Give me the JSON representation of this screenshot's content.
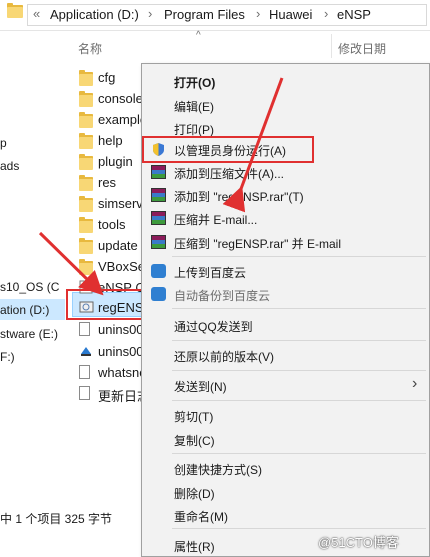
{
  "address_bar": {
    "overflow": "«",
    "crumbs": [
      "Application (D:)",
      "Program Files",
      "Huawei",
      "eNSP"
    ]
  },
  "columns": {
    "name": "名称",
    "modified": "修改日期"
  },
  "nav_pane": [
    "p",
    "ads",
    "s10_OS (C",
    "ation (D:)",
    "stware (E:)",
    "F:)"
  ],
  "files": [
    "cfg",
    "console",
    "example",
    "help",
    "plugin",
    "res",
    "simserver",
    "tools",
    "update",
    "VBoxSe",
    "eNSP C",
    "regENS",
    "unins00",
    "unins00",
    "whatsne",
    "更新日志"
  ],
  "status_bar": "中 1 个项目  325 字节",
  "context_menu": {
    "open": "打开(O)",
    "edit": "编辑(E)",
    "print": "打印(P)",
    "run_as_admin": "以管理员身份运行(A)",
    "add_to_archive": "添加到压缩文件(A)...",
    "add_to_rar": "添加到 \"regENSP.rar\"(T)",
    "compress_email": "压缩并 E-mail...",
    "compress_rar_email": "压缩到 \"regENSP.rar\" 并 E-mail",
    "upload_baidu": "上传到百度云",
    "auto_backup_baidu": "自动备份到百度云",
    "send_qq": "通过QQ发送到",
    "restore_previous": "还原以前的版本(V)",
    "send_to": "发送到(N)",
    "cut": "剪切(T)",
    "copy": "复制(C)",
    "create_shortcut": "创建快捷方式(S)",
    "delete": "删除(D)",
    "rename": "重命名(M)",
    "properties": "属性(R)"
  },
  "watermark": "@51CTO博客",
  "colors": {
    "highlight_red": "#e03030",
    "selection": "#cce8ff",
    "menu_bg": "#f2f2f2"
  }
}
